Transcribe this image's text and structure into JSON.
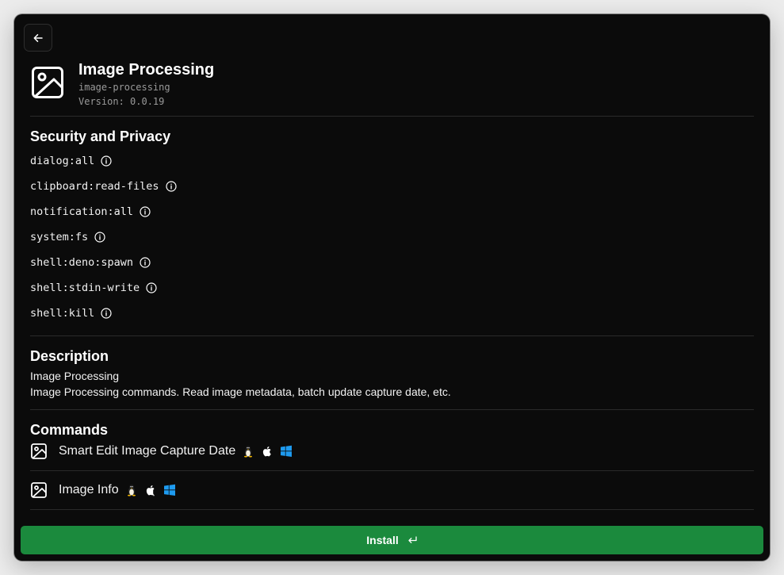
{
  "extension": {
    "title": "Image Processing",
    "identifier": "image-processing",
    "version": "Version: 0.0.19",
    "icon": "image-icon"
  },
  "security": {
    "heading": "Security and Privacy",
    "permissions": [
      "dialog:all",
      "clipboard:read-files",
      "notification:all",
      "system:fs",
      "shell:deno:spawn",
      "shell:stdin-write",
      "shell:kill"
    ]
  },
  "description": {
    "heading": "Description",
    "lines": [
      "Image Processing",
      "Image Processing commands. Read image metadata, batch update capture date, etc."
    ]
  },
  "commands": {
    "heading": "Commands",
    "items": [
      {
        "label": "Smart Edit Image Capture Date",
        "platforms": [
          "linux-icon",
          "apple-icon",
          "windows-icon"
        ]
      },
      {
        "label": "Image Info",
        "platforms": [
          "linux-icon",
          "apple-icon",
          "windows-icon"
        ]
      }
    ]
  },
  "install": {
    "label": "Install",
    "accent": "#1b8a3d"
  },
  "colors": {
    "background": "#0b0b0b",
    "divider": "#2a2a2a",
    "muted": "#9a9a9a",
    "windows_blue": "#1e9bf0"
  }
}
